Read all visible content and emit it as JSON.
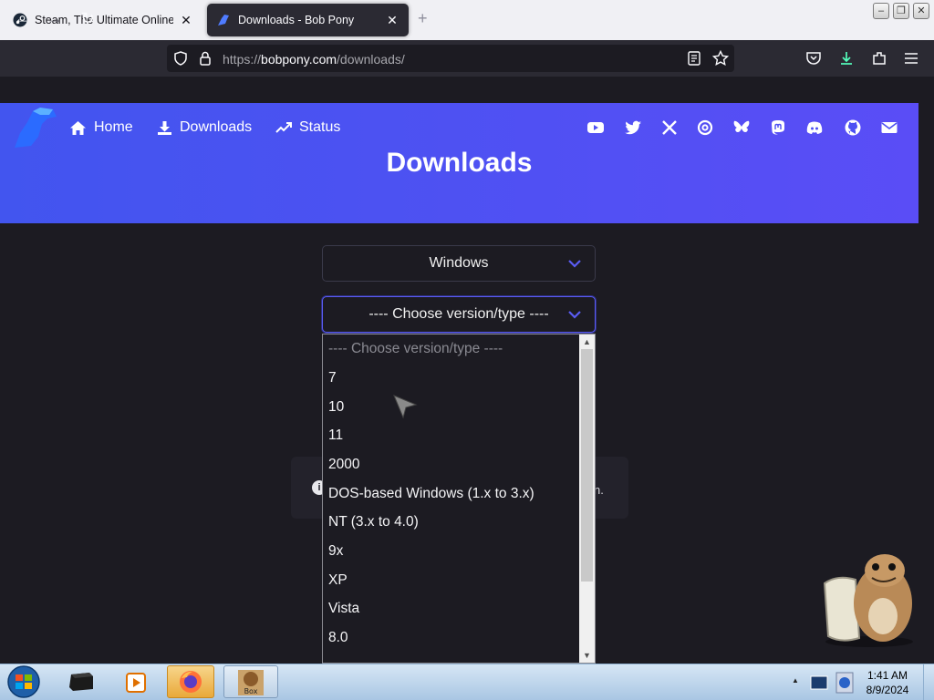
{
  "browser": {
    "tabs": [
      {
        "title": "Steam, The Ultimate Online Gar",
        "active": false
      },
      {
        "title": "Downloads - Bob Pony",
        "active": true
      }
    ],
    "url_prefix": "https://",
    "url_host": "bobpony.com",
    "url_path": "/downloads/"
  },
  "site": {
    "nav": {
      "home": "Home",
      "downloads": "Downloads",
      "status": "Status"
    },
    "social_icons": [
      "youtube-icon",
      "twitter-icon",
      "x-icon",
      "threads-icon",
      "bluesky-icon",
      "mastodon-icon",
      "discord-icon",
      "github-icon",
      "email-icon"
    ],
    "page_title": "Downloads",
    "os_select": {
      "value": "Windows"
    },
    "version_select": {
      "value": "---- Choose version/type ----",
      "options": [
        "---- Choose version/type ----",
        "7",
        "10",
        "11",
        "2000",
        "DOS-based Windows (1.x to 3.x)",
        "NT (3.x to 4.0)",
        "9x",
        "XP",
        "Vista",
        "8.0"
      ]
    },
    "info_fragment": "n."
  },
  "taskbar": {
    "time": "1:41 AM",
    "date": "8/9/2024"
  },
  "colors": {
    "accent": "#4f51f4",
    "page_bg": "#1c1b22"
  }
}
